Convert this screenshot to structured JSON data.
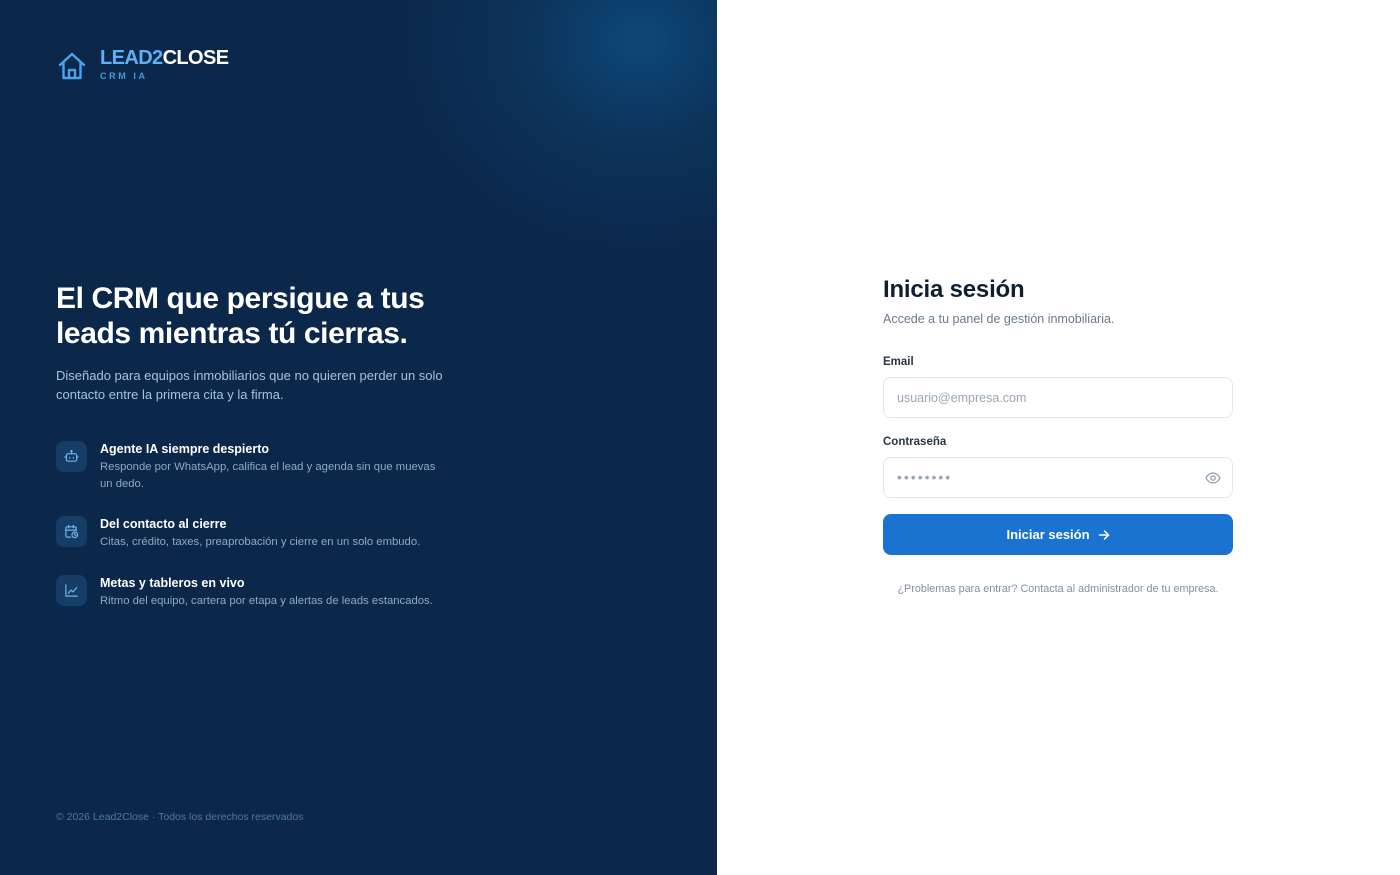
{
  "brand": {
    "name_part1": "LEAD2",
    "name_part2": "CLOSE",
    "subtitle": "CRM IA",
    "accent": "#5fb1f3"
  },
  "hero": {
    "headline_line1": "El CRM que persigue a tus",
    "headline_line2": "leads mientras tú cierras.",
    "intro": "Diseñado para equipos inmobiliarios que no quieren perder un solo contacto entre la primera cita y la firma."
  },
  "features": [
    {
      "icon": "bot-icon",
      "title": "Agente IA siempre despierto",
      "description": "Responde por WhatsApp, califica el lead y agenda sin que muevas un dedo."
    },
    {
      "icon": "calendar-clock-icon",
      "title": "Del contacto al cierre",
      "description": "Citas, crédito, taxes, preaprobación y cierre en un solo embudo."
    },
    {
      "icon": "chart-line-icon",
      "title": "Metas y tableros en vivo",
      "description": "Ritmo del equipo, cartera por etapa y alertas de leads estancados."
    }
  ],
  "footer": {
    "copyright": "© 2026 Lead2Close · Todos los derechos reservados"
  },
  "login": {
    "title": "Inicia sesión",
    "subtitle": "Accede a tu panel de gestión inmobiliaria.",
    "email_label": "Email",
    "email_placeholder": "usuario@empresa.com",
    "password_label": "Contraseña",
    "password_placeholder": "••••••••",
    "submit_label": "Iniciar sesión",
    "help_text": "¿Problemas para entrar? Contacta al administrador de tu empresa."
  },
  "colors": {
    "left_bg": "#0b2749",
    "button": "#1a73d1",
    "title": "#0f1f33"
  }
}
